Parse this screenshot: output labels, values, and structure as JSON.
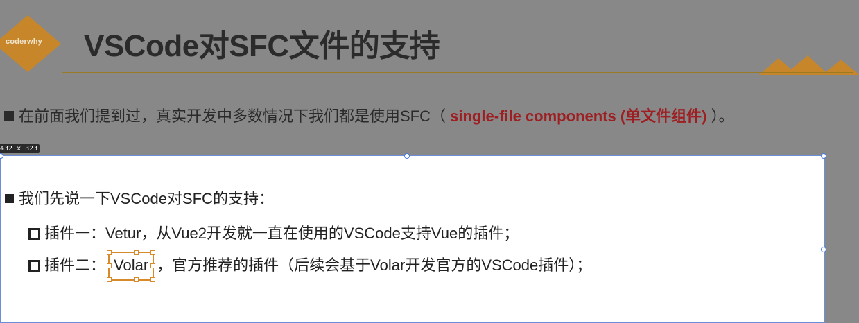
{
  "logo": {
    "text": "coderwhy"
  },
  "slide": {
    "title": "VSCode对SFC文件的支持",
    "bullet1": {
      "prefix": "在前面我们提到过，真实开发中多数情况下我们都是使用SFC（ ",
      "highlight": "single-file components (单文件组件)",
      "suffix": " ）。"
    }
  },
  "selection": {
    "size_label": "432 x 323"
  },
  "panel": {
    "heading": "我们先说一下VSCode对SFC的支持：",
    "item1": "插件一：Vetur，从Vue2开发就一直在使用的VSCode支持Vue的插件；",
    "item2_prefix": "插件二：",
    "item2_selected": "Volar",
    "item2_suffix": "，官方推荐的插件（后续会基于Volar开发官方的VSCode插件）；"
  },
  "colors": {
    "accent": "#9d1f22",
    "divider": "#9a7a25",
    "logo": "#c8862a",
    "selection": "#4a7be0",
    "object_selection": "#d88a2a"
  }
}
